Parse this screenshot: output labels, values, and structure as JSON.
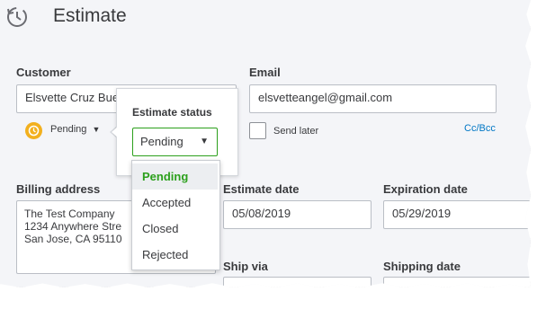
{
  "header": {
    "title": "Estimate",
    "icon": "estimate-clock-icon"
  },
  "customer": {
    "label": "Customer",
    "value": "Elsvette Cruz Bue"
  },
  "email": {
    "label": "Email",
    "value": "elsvetteangel@gmail.com",
    "send_later_label": "Send later",
    "cc_bcc_label": "Cc/Bcc"
  },
  "status_badge": {
    "label": "Pending",
    "icon": "clock-icon",
    "color": "#f2b01e"
  },
  "status_popover": {
    "title": "Estimate status",
    "selected": "Pending",
    "options": [
      "Pending",
      "Accepted",
      "Closed",
      "Rejected"
    ],
    "accent": "#2ca01c"
  },
  "billing": {
    "label": "Billing address",
    "lines": [
      "The Test Company",
      "1234 Anywhere Stre",
      "San Jose, CA  95110"
    ]
  },
  "estimate_date": {
    "label": "Estimate date",
    "value": "05/08/2019"
  },
  "expiration_date": {
    "label": "Expiration date",
    "value": "05/29/2019"
  },
  "ship_via": {
    "label": "Ship via"
  },
  "shipping_date": {
    "label": "Shipping date"
  }
}
